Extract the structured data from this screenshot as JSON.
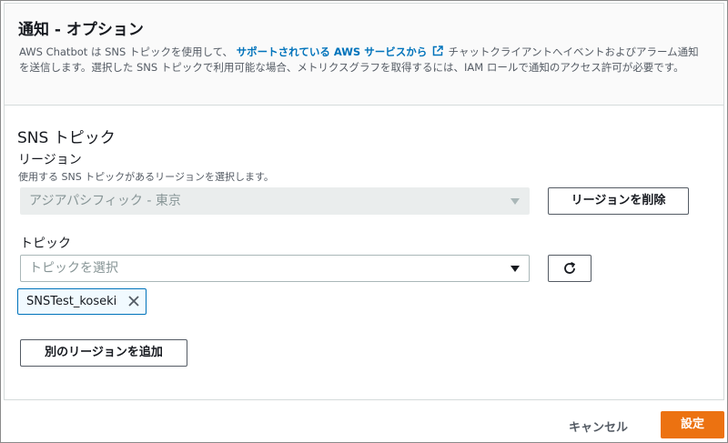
{
  "panel": {
    "title": "通知 - オプション",
    "desc_part1": "AWS Chatbot は SNS トピックを使用して、",
    "desc_link": "サポートされている AWS サービスから",
    "desc_part2": "チャットクライアントへイベントおよびアラーム通知を送信します。選択した SNS トピックで利用可能な場合、メトリクスグラフを取得するには、IAM ロールで通知のアクセス許可が必要です。"
  },
  "sns": {
    "section_title": "SNS トピック",
    "region_label": "リージョン",
    "region_hint": "使用する SNS トピックがあるリージョンを選択します。",
    "region_value": "アジアパシフィック - 東京",
    "remove_region_button": "リージョンを削除",
    "topic_label": "トピック",
    "topic_placeholder": "トピックを選択",
    "selected_topic": "SNSTest_koseki",
    "add_region_button": "別のリージョンを追加"
  },
  "footer": {
    "cancel_label": "キャンセル",
    "submit_label": "設定"
  },
  "colors": {
    "primary": "#ec7211",
    "link": "#0073bb",
    "token_border": "#0073bb"
  }
}
